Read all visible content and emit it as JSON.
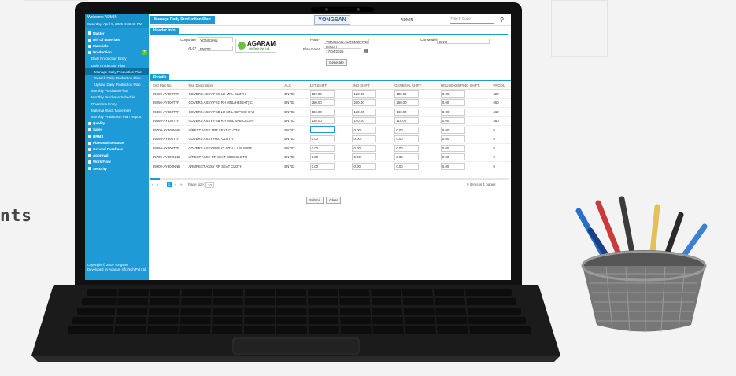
{
  "side_text": "nts",
  "sidebar": {
    "welcome": "Welcome  ADMIN",
    "date": "Saturday, April 5, 2025 4:33:40 PM",
    "items": [
      {
        "label": "Master",
        "level": 0
      },
      {
        "label": "Bill Of Materials",
        "level": 0
      },
      {
        "label": "Materials",
        "level": 0
      },
      {
        "label": "Production",
        "level": 0
      },
      {
        "label": "Daily Production Entry",
        "level": 1
      },
      {
        "label": "Daily Production Plan",
        "level": 1
      },
      {
        "label": "Manage Daily Production Plan",
        "level": 2,
        "active": true
      },
      {
        "label": "Search Daily Production Plan",
        "level": 2
      },
      {
        "label": "Upload Daily Production Plan",
        "level": 2
      },
      {
        "label": "Monthly Purchase Plan",
        "level": 1
      },
      {
        "label": "Monthly Purchase Schedule",
        "level": 1
      },
      {
        "label": "Downtime Entry",
        "level": 1
      },
      {
        "label": "Material Stock Movement",
        "level": 1
      },
      {
        "label": "Monthly Production Plan Report",
        "level": 1
      },
      {
        "label": "Quality",
        "level": 0
      },
      {
        "label": "Sales",
        "level": 0
      },
      {
        "label": "HRMS",
        "level": 0
      },
      {
        "label": "Plant Maintenance",
        "level": 0
      },
      {
        "label": "General Purchase",
        "level": 0
      },
      {
        "label": "Approval",
        "level": 0
      },
      {
        "label": "Work Flow",
        "level": 0
      },
      {
        "label": "Security",
        "level": 0
      }
    ],
    "copyright": "Copyright © 2019 Yongsan",
    "developer": "Developed by Agaram InfoTech Pvt Ltd."
  },
  "topbar": {
    "page_tab": "Manage Daily Production Plan",
    "logo": "YONGSAN",
    "user": "ADMIN",
    "search_placeholder": "Type F Code"
  },
  "header": {
    "tab": "Header Info",
    "corporate_label": "Corporate",
    "corporate_value": "YONGSAN",
    "alc_label": "ALC*",
    "alc_value": "BN702",
    "agaram_name": "AGARAM",
    "agaram_sub": "InfoTech Pvt. Ltd.",
    "plant_label": "Plant*",
    "plant_value": "YONGSAN AUTOMOTIVE INDIA I",
    "plan_date_label": "Plan Date*",
    "plan_date_value": "17/04/2025",
    "generate_label": "Generate",
    "car_model_label": "Car Model*",
    "car_model_value": "BN7I"
  },
  "details": {
    "tab": "Details",
    "columns": [
      "End Part No.",
      "Part Description",
      "ALC",
      "1ST SHIFT",
      "2ND SHIFT",
      "GENERAL SHIFT",
      "HOUSE KEEPING SHIFT",
      "PRODU"
    ],
    "rows": [
      [
        "89169-AY300TTR",
        "COVERS ASSY FSC LH MNL CLOTH",
        "BN702",
        "120.00",
        "120.00",
        "180.00",
        "0.00",
        "420"
      ],
      [
        "89259-AY300TTR",
        "COVERS ASSY FSC RH MNL(HEIGHT) C",
        "BN702",
        "260.00",
        "200.00",
        "250.00",
        "0.00",
        "650"
      ],
      [
        "89369-AY330TTR",
        "COVERS ASSY FSB LH MNL+B/PGC+SAB",
        "BN702",
        "150.00",
        "120.00",
        "140.00",
        "0.00",
        "410"
      ],
      [
        "89469-AY330TTR",
        "COVERS ASSY FSB RH MNL SAB CLOTH",
        "BN702",
        "120.00",
        "140.00",
        "110.00",
        "0.00",
        "380"
      ],
      [
        "89709-AY300NNB",
        "H/REST ASSY FRT SEAT CLOTH",
        "BN702",
        "",
        "0.00",
        "0.00",
        "0.00",
        "0"
      ],
      [
        "89169-AY300TTR",
        "COVERS ASSY RSC CLOTH",
        "BN702",
        "0.00",
        "0.00",
        "0.00",
        "0.00",
        "0"
      ],
      [
        "89369-AY300TTR",
        "COVERS ASSY RSB CLOTH + U/S WIRE",
        "BN702",
        "0.00",
        "0.00",
        "0.00",
        "0.00",
        "0"
      ],
      [
        "89709-AY300NNB",
        "H/REST ASSY RR SEAT SIDE CLOTH",
        "BN702",
        "0.00",
        "0.00",
        "0.00",
        "0.00",
        "0"
      ],
      [
        "89909-AY300NNB",
        "ARMREST ASSY RR SEAT CLOTH",
        "BN702",
        "0.00",
        "0.00",
        "0.00",
        "0.00",
        "0"
      ]
    ]
  },
  "pager": {
    "first": "«",
    "prev": "‹",
    "page": "1",
    "next": "›",
    "last": "»",
    "page_size_label": "Page size:",
    "page_size": "10",
    "summary": "9 items in 1 pages"
  },
  "actions": {
    "submit": "Submit",
    "clear": "Clear"
  },
  "colors": {
    "accent": "#1e9ad6",
    "green": "#6bbf3f"
  }
}
